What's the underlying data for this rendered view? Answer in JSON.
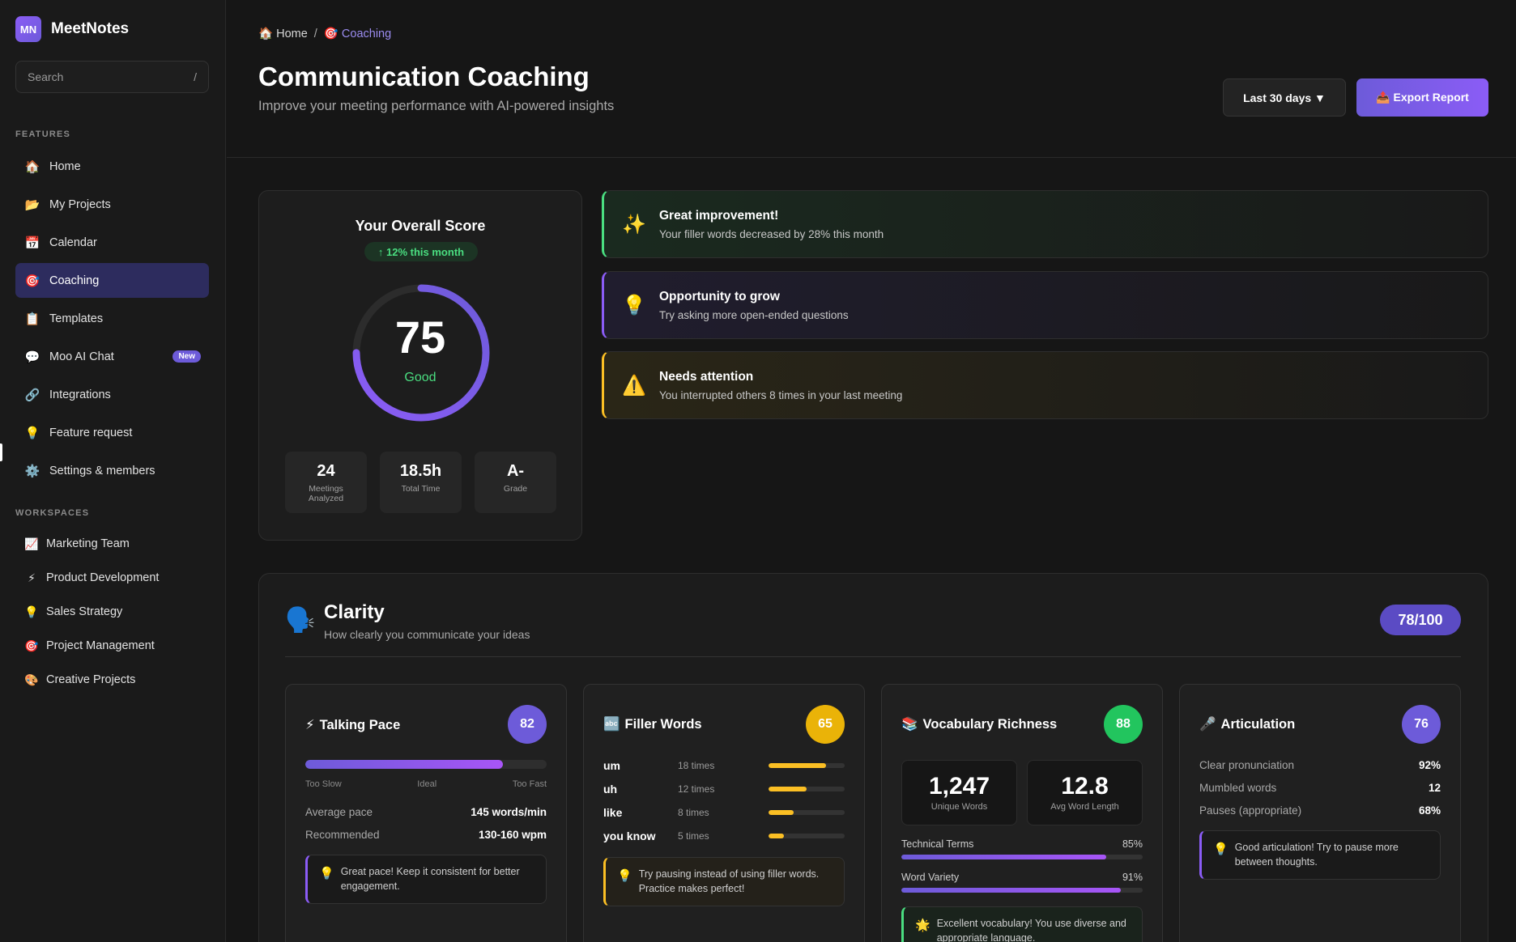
{
  "brand": {
    "logo": "MN",
    "name": "MeetNotes"
  },
  "search": {
    "placeholder": "Search",
    "shortcut": "/"
  },
  "sidebar": {
    "features_label": "FEATURES",
    "items": [
      {
        "icon": "🏠",
        "label": "Home"
      },
      {
        "icon": "📂",
        "label": "My Projects"
      },
      {
        "icon": "📅",
        "label": "Calendar"
      },
      {
        "icon": "🎯",
        "label": "Coaching",
        "active": true
      },
      {
        "icon": "📋",
        "label": "Templates"
      },
      {
        "icon": "💬",
        "label": "Moo AI Chat",
        "badge": "New"
      },
      {
        "icon": "🔗",
        "label": "Integrations"
      },
      {
        "icon": "💡",
        "label": "Feature request"
      },
      {
        "icon": "⚙️",
        "label": "Settings & members"
      }
    ],
    "workspaces_label": "WORKSPACES",
    "workspaces": [
      {
        "icon": "📈",
        "label": "Marketing Team"
      },
      {
        "icon": "⚡",
        "label": "Product Development"
      },
      {
        "icon": "💡",
        "label": "Sales Strategy"
      },
      {
        "icon": "🎯",
        "label": "Project Management"
      },
      {
        "icon": "🎨",
        "label": "Creative Projects"
      }
    ]
  },
  "breadcrumb": {
    "home_icon": "🏠",
    "home": "Home",
    "separator": "/",
    "current_icon": "🎯",
    "current": "Coaching"
  },
  "header": {
    "title": "Communication Coaching",
    "subtitle": "Improve your meeting performance with AI-powered insights",
    "range_button": "Last 30 days ▼",
    "export_button": "📤 Export Report"
  },
  "overall": {
    "title": "Your Overall Score",
    "trend": "↑ 12% this month",
    "score": "75",
    "score_fraction": 0.75,
    "rating": "Good",
    "stats": [
      {
        "value": "24",
        "label": "Meetings Analyzed"
      },
      {
        "value": "18.5h",
        "label": "Total Time"
      },
      {
        "value": "A-",
        "label": "Grade"
      }
    ]
  },
  "insights": [
    {
      "icon": "✨",
      "title": "Great improvement!",
      "text": "Your filler words decreased by 28% this month"
    },
    {
      "icon": "💡",
      "title": "Opportunity to grow",
      "text": "Try asking more open-ended questions"
    },
    {
      "icon": "⚠️",
      "title": "Needs attention",
      "text": "You interrupted others 8 times in your last meeting"
    }
  ],
  "clarity": {
    "icon": "🗣️",
    "title": "Clarity",
    "subtitle": "How clearly you communicate your ideas",
    "score": "78/100",
    "pace": {
      "icon": "⚡",
      "title": "Talking Pace",
      "score": "82",
      "fill": 0.82,
      "scale": [
        "Too Slow",
        "Ideal",
        "Too Fast"
      ],
      "rows": [
        {
          "label": "Average pace",
          "value": "145 words/min"
        },
        {
          "label": "Recommended",
          "value": "130-160 wpm"
        }
      ],
      "tip": "Great pace! Keep it consistent for better engagement."
    },
    "filler": {
      "icon": "🔤",
      "title": "Filler Words",
      "score": "65",
      "words": [
        {
          "word": "um",
          "count": "18 times",
          "level": 0.75
        },
        {
          "word": "uh",
          "count": "12 times",
          "level": 0.5
        },
        {
          "word": "like",
          "count": "8 times",
          "level": 0.33
        },
        {
          "word": "you know",
          "count": "5 times",
          "level": 0.2
        }
      ],
      "tip": "Try pausing instead of using filler words. Practice makes perfect!"
    },
    "vocab": {
      "icon": "📚",
      "title": "Vocabulary Richness",
      "score": "88",
      "boxes": [
        {
          "value": "1,247",
          "label": "Unique Words"
        },
        {
          "value": "12.8",
          "label": "Avg Word Length"
        }
      ],
      "bars": [
        {
          "label": "Technical Terms",
          "value": "85%",
          "level": 0.85
        },
        {
          "label": "Word Variety",
          "value": "91%",
          "level": 0.91
        }
      ],
      "tip": "Excellent vocabulary! You use diverse and appropriate language."
    },
    "articulation": {
      "icon": "🎤",
      "title": "Articulation",
      "score": "76",
      "rows": [
        {
          "label": "Clear pronunciation",
          "value": "92%"
        },
        {
          "label": "Mumbled words",
          "value": "12"
        },
        {
          "label": "Pauses (appropriate)",
          "value": "68%"
        }
      ],
      "tip": "Good articulation! Try to pause more between thoughts."
    }
  },
  "colors": {
    "accent": "#6d5bd9",
    "green": "#4ade80",
    "yellow": "#fbbf24",
    "purple": "#8b5cf6"
  }
}
